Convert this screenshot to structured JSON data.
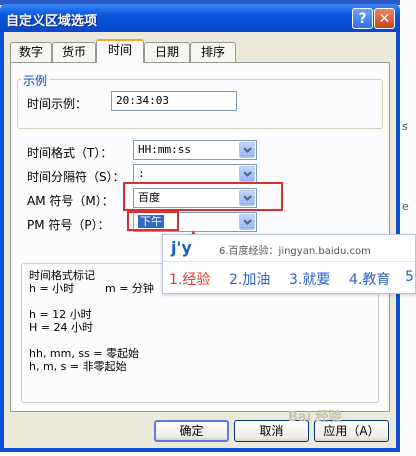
{
  "background": {
    "peek_chars": [
      "s",
      "e"
    ]
  },
  "dialog": {
    "title": "自定义区域选项",
    "help_label": "?",
    "close_label": "✕",
    "tabs": [
      {
        "label": "数字",
        "active": false
      },
      {
        "label": "货币",
        "active": false
      },
      {
        "label": "时间",
        "active": true
      },
      {
        "label": "日期",
        "active": false
      },
      {
        "label": "排序",
        "active": false
      }
    ],
    "example": {
      "legend": "示例",
      "label": "时间示例：",
      "value": "20:34:03"
    },
    "fields": {
      "time_format": {
        "label": "时间格式（T）：",
        "value": "HH:mm:ss"
      },
      "time_separator": {
        "label": "时间分隔符（S）：",
        "value": ":"
      },
      "am_symbol": {
        "label": "AM 符号（M）：",
        "value": "百度"
      },
      "pm_symbol": {
        "label": "PM 符号（P）：",
        "value": "下午"
      }
    },
    "notation": {
      "title": "时间格式标记",
      "line1_left": "h = 小时",
      "line1_right": "m = 分钟",
      "line2": "h = 12 小时",
      "line3": "H = 24 小时",
      "line4": "hh, mm, ss = 零起始",
      "line5": "h, m, s = 非零起始"
    },
    "buttons": {
      "ok": "确定",
      "cancel": "取消",
      "apply": "应用（A）"
    }
  },
  "ime_popup": {
    "composition": "j'y",
    "hint": "6.百度经验：jingyan.baidu.com",
    "candidates": [
      "1.经验",
      "2.加油",
      "3.就要",
      "4.教育",
      "5"
    ]
  },
  "watermark": "Bai 经验",
  "colors": {
    "title_bar": "#0a55e0",
    "annotation_red": "#d83030",
    "candidate_highlight": "#e03a2a",
    "candidate_text": "#2a62c7"
  }
}
